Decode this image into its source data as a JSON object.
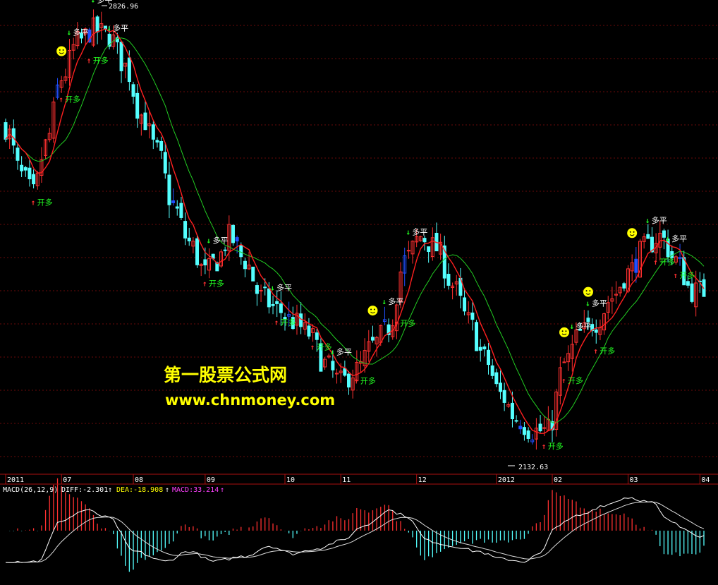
{
  "chart_data": [
    {
      "type": "candlestick",
      "title": "",
      "signal_labels": {
        "buy": "开多",
        "sell": "多平"
      },
      "price_high_label": "2826.96",
      "price_low_label": "2132.63",
      "x_tick_labels": [
        "2011",
        "07",
        "08",
        "09",
        "10",
        "11",
        "12",
        "2012",
        "02",
        "03",
        "04"
      ],
      "ylim": [
        2080,
        2840
      ],
      "colors": {
        "up": "#ff3030",
        "down": "#54ffff",
        "ma_fast": "#ff2020",
        "ma_slow": "#22cc22",
        "neutral": "#ffffff",
        "blue": "#2050ff"
      },
      "anchors": [
        [
          0,
          2640
        ],
        [
          4,
          2560
        ],
        [
          7,
          2530
        ],
        [
          10,
          2610
        ],
        [
          14,
          2720
        ],
        [
          18,
          2780
        ],
        [
          22,
          2800
        ],
        [
          26,
          2790
        ],
        [
          30,
          2740
        ],
        [
          34,
          2660
        ],
        [
          38,
          2600
        ],
        [
          42,
          2510
        ],
        [
          46,
          2450
        ],
        [
          50,
          2400
        ],
        [
          53,
          2420
        ],
        [
          56,
          2460
        ],
        [
          60,
          2420
        ],
        [
          64,
          2360
        ],
        [
          68,
          2340
        ],
        [
          72,
          2320
        ],
        [
          76,
          2300
        ],
        [
          80,
          2250
        ],
        [
          84,
          2220
        ],
        [
          88,
          2240
        ],
        [
          92,
          2280
        ],
        [
          96,
          2310
        ],
        [
          100,
          2420
        ],
        [
          104,
          2460
        ],
        [
          108,
          2440
        ],
        [
          112,
          2380
        ],
        [
          116,
          2320
        ],
        [
          120,
          2260
        ],
        [
          124,
          2200
        ],
        [
          128,
          2160
        ],
        [
          132,
          2140
        ],
        [
          136,
          2140
        ],
        [
          140,
          2250
        ],
        [
          144,
          2300
        ],
        [
          148,
          2320
        ],
        [
          152,
          2360
        ],
        [
          156,
          2400
        ],
        [
          160,
          2440
        ],
        [
          164,
          2460
        ],
        [
          168,
          2420
        ],
        [
          172,
          2370
        ]
      ],
      "signals": [
        {
          "i": 7,
          "type": "buy"
        },
        {
          "i": 14,
          "type": "buy"
        },
        {
          "i": 16,
          "type": "sell"
        },
        {
          "i": 21,
          "type": "buy"
        },
        {
          "i": 22,
          "type": "sell"
        },
        {
          "i": 26,
          "type": "sell"
        },
        {
          "i": 50,
          "type": "buy"
        },
        {
          "i": 51,
          "type": "sell"
        },
        {
          "i": 67,
          "type": "sell"
        },
        {
          "i": 68,
          "type": "buy"
        },
        {
          "i": 77,
          "type": "buy"
        },
        {
          "i": 82,
          "type": "sell"
        },
        {
          "i": 88,
          "type": "buy"
        },
        {
          "i": 95,
          "type": "sell"
        },
        {
          "i": 98,
          "type": "buy"
        },
        {
          "i": 101,
          "type": "sell"
        },
        {
          "i": 135,
          "type": "buy"
        },
        {
          "i": 140,
          "type": "buy"
        },
        {
          "i": 142,
          "type": "sell"
        },
        {
          "i": 146,
          "type": "sell"
        },
        {
          "i": 148,
          "type": "buy"
        },
        {
          "i": 161,
          "type": "sell"
        },
        {
          "i": 163,
          "type": "buy"
        },
        {
          "i": 166,
          "type": "sell"
        },
        {
          "i": 168,
          "type": "buy"
        }
      ],
      "smileys": [
        14,
        92,
        140,
        146,
        157
      ]
    },
    {
      "type": "macd",
      "title": "MACD(26,12,9)",
      "series": [
        {
          "name": "DIFF",
          "value": "DIFF:-2.301"
        },
        {
          "name": "DEA",
          "value": "DEA:-18.908"
        },
        {
          "name": "MACD",
          "value": "MACD:33.214"
        }
      ],
      "colors": {
        "DIFF": "#ffffff",
        "DEA": "#ffff00",
        "MACD": "#ff40ff",
        "hist_up": "#ff3030",
        "hist_down": "#54ffff"
      },
      "anchors": [
        [
          0,
          -60
        ],
        [
          8,
          -60
        ],
        [
          14,
          20
        ],
        [
          20,
          40
        ],
        [
          26,
          25
        ],
        [
          32,
          -40
        ],
        [
          40,
          -60
        ],
        [
          46,
          -40
        ],
        [
          52,
          -60
        ],
        [
          60,
          -50
        ],
        [
          66,
          -30
        ],
        [
          72,
          -45
        ],
        [
          78,
          -35
        ],
        [
          84,
          -20
        ],
        [
          90,
          10
        ],
        [
          96,
          40
        ],
        [
          100,
          30
        ],
        [
          106,
          -20
        ],
        [
          112,
          -30
        ],
        [
          118,
          -40
        ],
        [
          124,
          -55
        ],
        [
          130,
          -60
        ],
        [
          134,
          -45
        ],
        [
          138,
          10
        ],
        [
          144,
          30
        ],
        [
          150,
          50
        ],
        [
          156,
          65
        ],
        [
          162,
          55
        ],
        [
          166,
          20
        ],
        [
          170,
          5
        ],
        [
          174,
          -10
        ]
      ],
      "ylim": [
        -80,
        80
      ]
    }
  ]
}
